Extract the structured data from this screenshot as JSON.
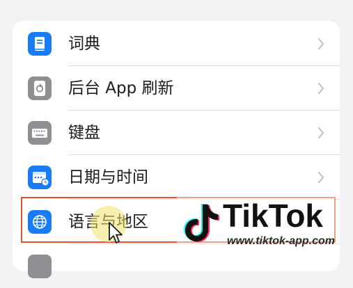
{
  "settings": {
    "items": [
      {
        "label": "词典",
        "icon": "dictionary-icon",
        "color": "#1a7cf5"
      },
      {
        "label": "后台 App 刷新",
        "icon": "background-refresh-icon",
        "color": "#8e8e93"
      },
      {
        "label": "键盘",
        "icon": "keyboard-icon",
        "color": "#8e8e93"
      },
      {
        "label": "日期与时间",
        "icon": "date-time-icon",
        "color": "#1a7cf5"
      },
      {
        "label": "语言与地区",
        "icon": "globe-icon",
        "color": "#1a7cf5"
      }
    ]
  },
  "watermark": {
    "name": "TikTok",
    "url": "www.tiktok-app.com"
  },
  "colors": {
    "highlight": "#e0532b",
    "accent": "#1a7cf5"
  }
}
